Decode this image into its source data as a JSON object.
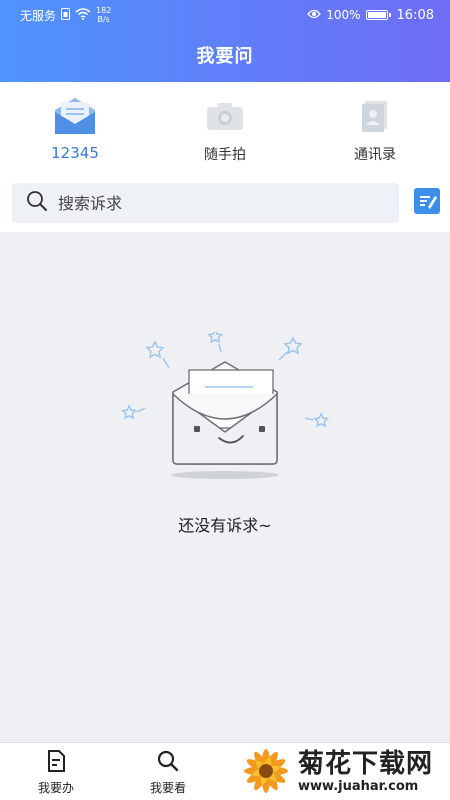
{
  "status_bar": {
    "carrier": "无服务",
    "speed": "182",
    "speed_unit": "B/s",
    "battery": "100%",
    "time": "16:08"
  },
  "header": {
    "title": "我要问"
  },
  "tabs": [
    {
      "label": "12345",
      "icon": "mail-icon",
      "active": true
    },
    {
      "label": "随手拍",
      "icon": "camera-icon",
      "active": false
    },
    {
      "label": "通讯录",
      "icon": "contacts-icon",
      "active": false
    }
  ],
  "search": {
    "placeholder": "搜索诉求"
  },
  "empty_state": {
    "message": "还没有诉求~"
  },
  "bottom_nav": [
    {
      "label": "我要办",
      "icon": "document-icon"
    },
    {
      "label": "我要看",
      "icon": "search-icon"
    }
  ],
  "watermark": {
    "name": "菊花下载网",
    "url": "www.juahar.com"
  },
  "colors": {
    "header_start": "#4f93ff",
    "header_end": "#6f6df5",
    "accent": "#3a7bd5"
  }
}
